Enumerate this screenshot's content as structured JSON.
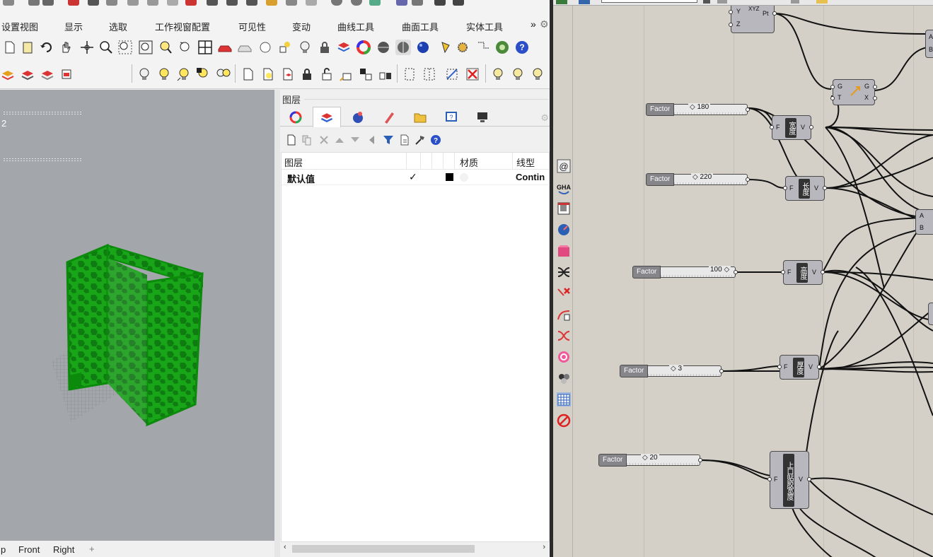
{
  "menu_tabs": [
    "设置视图",
    "显示",
    "选取",
    "工作视窗配置",
    "可见性",
    "变动",
    "曲线工具",
    "曲面工具",
    "实体工具"
  ],
  "menu_more": "»",
  "viewport": {
    "label": "2"
  },
  "viewport_tabs": [
    "p",
    "Front",
    "Right"
  ],
  "viewport_add": "+",
  "layer_panel": {
    "title": "图层",
    "columns": {
      "name": "图层",
      "material": "材质",
      "linetype": "线型"
    },
    "rows": [
      {
        "name": "默认值",
        "check": "✓",
        "linetype": "Contin"
      }
    ]
  },
  "scroll": {
    "left": "‹",
    "right": "›"
  },
  "grasshopper": {
    "sliders": [
      {
        "label": "Factor",
        "value": "◇ 180"
      },
      {
        "label": "Factor",
        "value": "◇ 220"
      },
      {
        "label": "Factor",
        "value": "100 ◇"
      },
      {
        "label": "Factor",
        "value": "◇ 3"
      },
      {
        "label": "Factor",
        "value": "◇ 20"
      }
    ],
    "components": [
      {
        "in": "F",
        "core": "宽度",
        "out": "V"
      },
      {
        "in": "F",
        "core": "长度",
        "out": "V"
      },
      {
        "in": "F",
        "core": "高度",
        "out": "V"
      },
      {
        "in": "F",
        "core": "厚度",
        "out": "V"
      },
      {
        "in": "F",
        "core": "上口贴胶宽度",
        "out": "V"
      }
    ],
    "xyz": {
      "y": "Y",
      "z": "Z",
      "pt": "Pt",
      "title": "XYZ"
    },
    "move": {
      "g": "G",
      "t": "T",
      "g_out": "G",
      "x_out": "X"
    },
    "ab": {
      "a": "A",
      "b": "B"
    },
    "side_gha": "GHA"
  }
}
